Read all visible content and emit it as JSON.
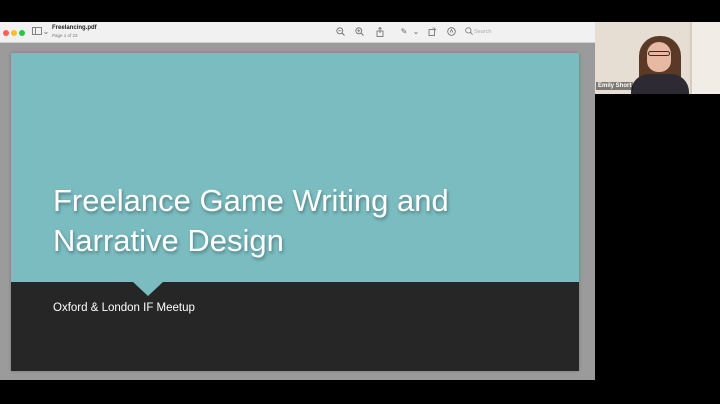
{
  "viewer": {
    "title": "Freelancing.pdf",
    "page_info": "Page 1 of 23",
    "search_placeholder": "Search",
    "icons": {
      "sidebar": "sidebar-icon",
      "zoom_out": "zoom-out-icon",
      "zoom_in": "zoom-in-icon",
      "share": "share-icon",
      "markup": "pencil-icon",
      "rotate": "rotate-icon",
      "annotate": "markup-circle-icon",
      "search": "search-icon"
    }
  },
  "slide": {
    "title_line1": "Freelance Game Writing and",
    "title_line2": "Narrative Design",
    "subtitle": "Oxford & London IF Meetup",
    "colors": {
      "top": "#7abcc0",
      "bottom": "#262626"
    }
  },
  "video": {
    "participant_name": "Emily Short"
  }
}
